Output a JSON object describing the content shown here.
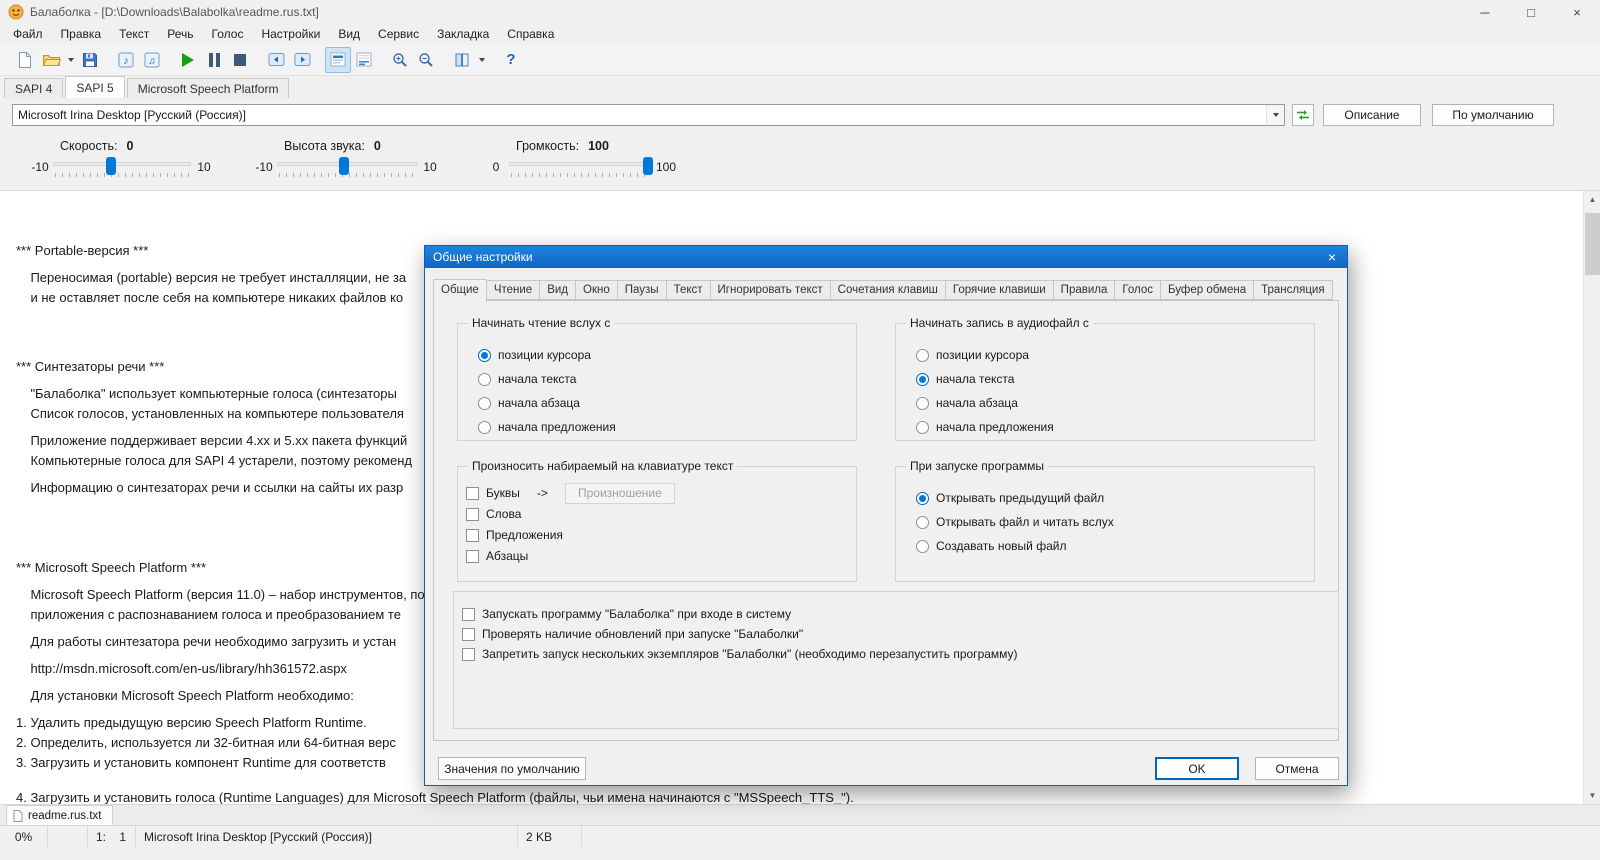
{
  "colors": {
    "accent": "#0078d7",
    "dialog_titlebar": "#1272d4",
    "play_green": "#17a017"
  },
  "titlebar": {
    "title": "Балаболка - [D:\\Downloads\\Balabolka\\readme.rus.txt]",
    "minimize": "─",
    "maximize": "□",
    "close": "×"
  },
  "menubar": {
    "items": [
      "Файл",
      "Правка",
      "Текст",
      "Речь",
      "Голос",
      "Настройки",
      "Вид",
      "Сервис",
      "Закладка",
      "Справка"
    ]
  },
  "toolbar": {
    "icons": [
      "new-file",
      "open-file",
      "open-file-dropdown",
      "save-file",
      "save-audio",
      "split-audio",
      "play",
      "pause",
      "stop",
      "prev-fragment",
      "next-fragment",
      "highlight-text",
      "subtitles",
      "magnifier-plus",
      "magnifier-minus",
      "dictionary",
      "dictionary-dropdown",
      "help"
    ]
  },
  "sapi_tabs": {
    "items": [
      {
        "label": "SAPI 4",
        "active": false
      },
      {
        "label": "SAPI 5",
        "active": true
      },
      {
        "label": "Microsoft Speech Platform",
        "active": false
      }
    ]
  },
  "voice_panel": {
    "voice": "Microsoft Irina Desktop [Русский (Россия)]",
    "description_button": "Описание",
    "default_button": "По умолчанию"
  },
  "sliders": {
    "rate": {
      "label": "Скорость:",
      "value": "0",
      "min": "-10",
      "max": "10"
    },
    "pitch": {
      "label": "Высота звука:",
      "value": "0",
      "min": "-10",
      "max": "10"
    },
    "volume": {
      "label": "Громкость:",
      "value": "100",
      "min": "0",
      "max": "100"
    }
  },
  "document": {
    "lines": [
      {
        "cls": "",
        "text": "*** Portable-версия ***"
      },
      {
        "cls": "p",
        "text": "    Переносимая (portable) версия не требует инсталляции, не за"
      },
      {
        "cls": "",
        "text": "    и не оставляет после себя на компьютере никаких файлов ко"
      },
      {
        "cls": "sec1",
        "text": "*** Синтезаторы речи ***"
      },
      {
        "cls": "p",
        "text": "    \"Балаболка\" использует компьютерные голоса (синтезаторы"
      },
      {
        "cls": "",
        "text": "    Список голосов, установленных на компьютере пользователя"
      },
      {
        "cls": "p",
        "text": "    Приложение поддерживает версии 4.xx и 5.xx пакета функций"
      },
      {
        "cls": "",
        "text": "    Компьютерные голоса для SAPI 4 устарели, поэтому рекоменд"
      },
      {
        "cls": "p",
        "text": "    Информацию о синтезаторах речи и ссылки на сайты их разр"
      },
      {
        "cls": "sec2",
        "text": "*** Microsoft Speech Platform ***"
      },
      {
        "cls": "p",
        "text": "    Microsoft Speech Platform (версия 11.0) – набор инструментов, по"
      },
      {
        "cls": "",
        "text": "    приложения с распознаванием голоса и преобразованием те"
      },
      {
        "cls": "p",
        "text": "    Для работы синтезатора речи необходимо загрузить и устан"
      },
      {
        "cls": "p",
        "text": "    http://msdn.microsoft.com/en-us/library/hh361572.aspx"
      },
      {
        "cls": "p",
        "text": "    Для установки Microsoft Speech Platform необходимо:"
      },
      {
        "cls": "p",
        "text": "1. Удалить предыдущую версию Speech Platform Runtime."
      },
      {
        "cls": "",
        "text": "2. Определить, используется ли 32-битная или 64-битная верс"
      },
      {
        "cls": "",
        "text": "3. Загрузить и установить компонент Runtime для соответств"
      },
      {
        "cls": "last",
        "text": "4. Загрузить и установить голоса (Runtime Languages) для Microsoft Speech Platform (файлы, чьи имена начинаются с \"MSSpeech_TTS_\")."
      }
    ]
  },
  "dialog": {
    "title": "Общие настройки",
    "close": "×",
    "tabs": [
      {
        "label": "Общие",
        "active": true
      },
      {
        "label": "Чтение",
        "active": false
      },
      {
        "label": "Вид",
        "active": false
      },
      {
        "label": "Окно",
        "active": false
      },
      {
        "label": "Паузы",
        "active": false
      },
      {
        "label": "Текст",
        "active": false
      },
      {
        "label": "Игнорировать текст",
        "active": false
      },
      {
        "label": "Сочетания клавиш",
        "active": false
      },
      {
        "label": "Горячие клавиши",
        "active": false
      },
      {
        "label": "Правила",
        "active": false
      },
      {
        "label": "Голос",
        "active": false
      },
      {
        "label": "Буфер обмена",
        "active": false
      },
      {
        "label": "Трансляция",
        "active": false
      }
    ],
    "read_start_group": {
      "title": "Начинать чтение вслух с",
      "options": [
        {
          "label": "позиции курсора",
          "checked": true
        },
        {
          "label": "начала текста",
          "checked": false
        },
        {
          "label": "начала абзаца",
          "checked": false
        },
        {
          "label": "начала предложения",
          "checked": false
        }
      ]
    },
    "record_start_group": {
      "title": "Начинать запись в аудиофайл с",
      "options": [
        {
          "label": "позиции курсора",
          "checked": false
        },
        {
          "label": "начала текста",
          "checked": true
        },
        {
          "label": "начала абзаца",
          "checked": false
        },
        {
          "label": "начала предложения",
          "checked": false
        }
      ]
    },
    "typing_group": {
      "title": "Произносить набираемый на клавиатуре текст",
      "letters": {
        "label": "Буквы",
        "checked": false
      },
      "arrow": "->",
      "pronunciation_button": "Произношение",
      "options": [
        {
          "label": "Слова",
          "checked": false
        },
        {
          "label": "Предложения",
          "checked": false
        },
        {
          "label": "Абзацы",
          "checked": false
        }
      ]
    },
    "startup_group": {
      "title": "При запуске программы",
      "options": [
        {
          "label": "Открывать предыдущий файл",
          "checked": true
        },
        {
          "label": "Открывать файл и читать вслух",
          "checked": false
        },
        {
          "label": "Создавать новый файл",
          "checked": false
        }
      ]
    },
    "misc_group": {
      "options": [
        {
          "label": "Запускать программу \"Балаболка\" при входе в систему",
          "checked": false
        },
        {
          "label": "Проверять наличие обновлений при запуске \"Балаболки\"",
          "checked": false
        },
        {
          "label": "Запретить запуск нескольких экземпляров \"Балаболки\" (необходимо перезапустить программу)",
          "checked": false
        }
      ]
    },
    "defaults_button": "Значения по умолчанию",
    "ok_button": "OK",
    "cancel_button": "Отмена"
  },
  "file_tabs": {
    "items": [
      {
        "label": "readme.rus.txt",
        "active": true
      }
    ]
  },
  "statusbar": {
    "progress": "0%",
    "caret": "1:    1",
    "voice": "Microsoft Irina Desktop [Русский (Россия)]",
    "size": "2 KB"
  }
}
